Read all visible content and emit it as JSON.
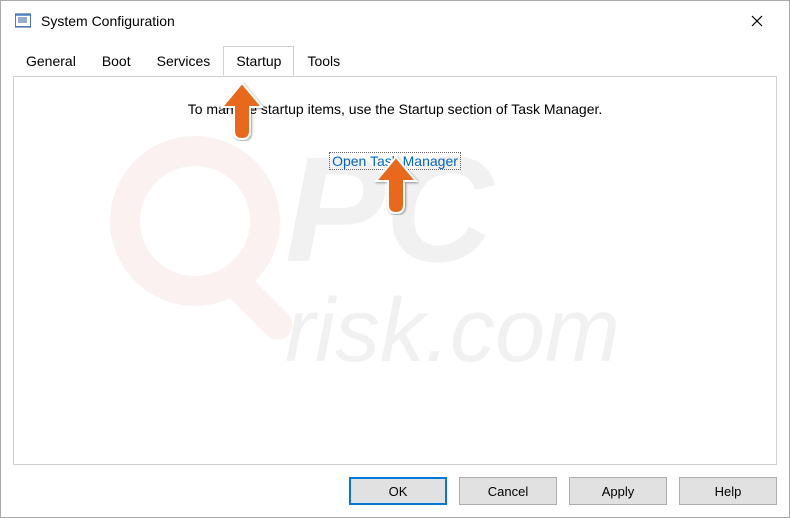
{
  "window": {
    "title": "System Configuration"
  },
  "tabs": {
    "general": "General",
    "boot": "Boot",
    "services": "Services",
    "startup": "Startup",
    "tools": "Tools"
  },
  "panel": {
    "message": "To manage startup items, use the Startup section of Task Manager.",
    "link_label": "Open Task Manager"
  },
  "buttons": {
    "ok": "OK",
    "cancel": "Cancel",
    "apply": "Apply",
    "help": "Help"
  },
  "watermark": {
    "text1": "PC",
    "text2": "risk.com"
  }
}
